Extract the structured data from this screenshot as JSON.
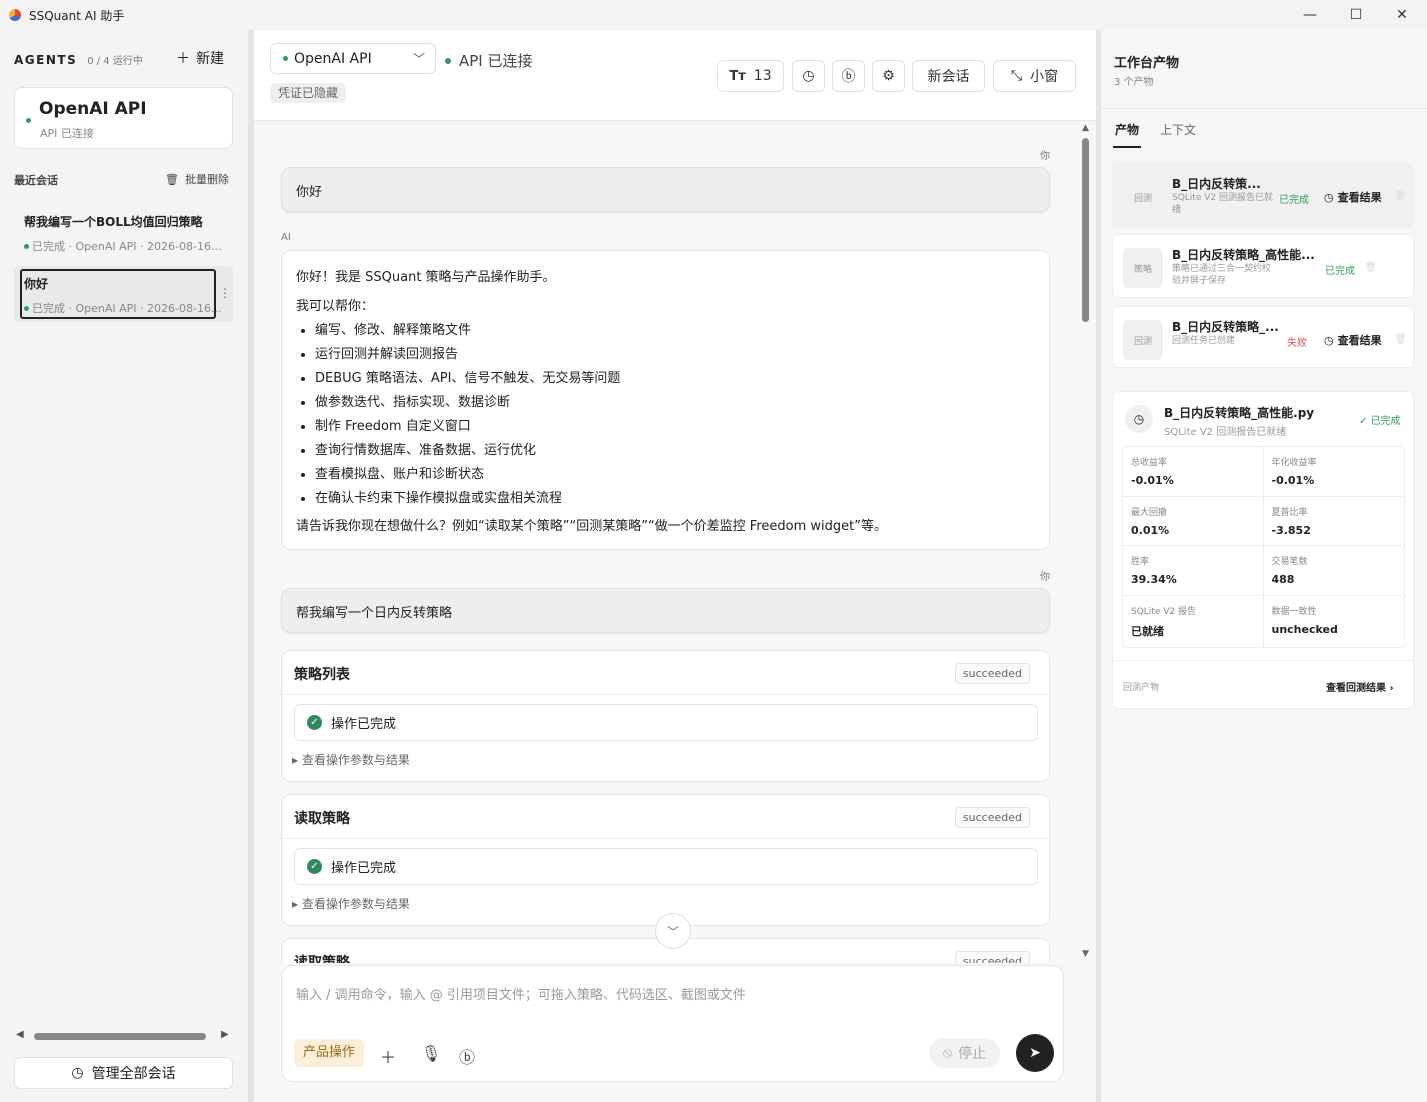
{
  "window": {
    "title": "SSQuant AI 助手",
    "minimize": "—",
    "maximize": "☐",
    "close": "✕"
  },
  "sidebar": {
    "agents_label": "AGENTS",
    "running_count": "0 / 4 运行中",
    "new_label": "新建",
    "agent": {
      "name": "OpenAI API",
      "status": "API 已连接"
    },
    "recent_label": "最近会话",
    "bulk_delete_label": "批量删除",
    "sessions": [
      {
        "title": "帮我编写一个BOLL均值回归策略",
        "meta": "已完成 · OpenAI API · 2026-08-16..."
      },
      {
        "title": "你好",
        "meta": "已完成 · OpenAI API · 2026-08-16..."
      }
    ],
    "manage_label": "管理全部会话"
  },
  "toolbar": {
    "model": "OpenAI API",
    "api_status": "API 已连接",
    "credential": "凭证已隐藏",
    "font_size": "13",
    "new_chat": "新会话",
    "mini_window": "小窗"
  },
  "chat": {
    "user_label": "你",
    "ai_label": "AI",
    "msg1": "你好",
    "ai_reply": {
      "intro": "你好！我是 SSQuant 策略与产品操作助手。",
      "can_help": "我可以帮你：",
      "items": [
        "编写、修改、解释策略文件",
        "运行回测并解读回测报告",
        "DEBUG 策略语法、API、信号不触发、无交易等问题",
        "做参数迭代、指标实现、数据诊断",
        "制作 Freedom 自定义窗口",
        "查询行情数据库、准备数据、运行优化",
        "查看模拟盘、账户和诊断状态",
        "在确认卡约束下操作模拟盘或实盘相关流程"
      ],
      "outro": "请告诉我你现在想做什么？例如“读取某个策略”“回测某策略”“做一个价差监控 Freedom widget”等。"
    },
    "msg2": "帮我编写一个日内反转策略",
    "tools": [
      {
        "name": "策略列表",
        "status": "succeeded",
        "result": "操作已完成",
        "more": "查看操作参数与结果"
      },
      {
        "name": "读取策略",
        "status": "succeeded",
        "result": "操作已完成",
        "more": "查看操作参数与结果"
      },
      {
        "name": "读取策略",
        "status": "succeeded"
      }
    ]
  },
  "composer": {
    "placeholder": "输入 / 调用命令，输入 @ 引用项目文件；可拖入策略、代码选区、截图或文件",
    "mode": "产品操作",
    "stop_label": "停止"
  },
  "artifacts": {
    "title": "工作台产物",
    "count": "3 个产物",
    "tabs": [
      "产物",
      "上下文"
    ],
    "items": [
      {
        "thumb": "回测",
        "name": "B_日内反转策...",
        "desc": "SQLite V2 回测报告已就绪",
        "status": "已完成",
        "status_color": "#2f9e5a",
        "view": "查看结果"
      },
      {
        "thumb": "策略",
        "name": "B_日内反转策略_高性能...",
        "desc": "策略已通过三合一契约校验并屏子保存",
        "status": "已完成",
        "status_color": "#2f9e5a"
      },
      {
        "thumb": "回测",
        "name": "B_日内反转策略_...",
        "desc": "回测任务已创建",
        "status": "失败",
        "status_color": "#d9534f",
        "view": "查看结果"
      }
    ],
    "detail": {
      "name": "B_日内反转策略_高性能.py",
      "desc": "SQLite V2 回测报告已就绪",
      "status": "已完成",
      "metrics": [
        {
          "label": "总收益率",
          "value": "-0.01%"
        },
        {
          "label": "年化收益率",
          "value": "-0.01%"
        },
        {
          "label": "最大回撤",
          "value": "0.01%"
        },
        {
          "label": "夏普比率",
          "value": "-3.852"
        },
        {
          "label": "胜率",
          "value": "39.34%"
        },
        {
          "label": "交易笔数",
          "value": "488"
        },
        {
          "label": "SQLite V2 报告",
          "value": "已就绪"
        },
        {
          "label": "数据一致性",
          "value": "unchecked"
        }
      ],
      "footer_left": "回测产物",
      "footer_right": "查看回测结果"
    }
  },
  "colors": {
    "accent_green": "#2f9e5a",
    "fail_red": "#d9534f",
    "mode_bg": "#fbefd9"
  }
}
